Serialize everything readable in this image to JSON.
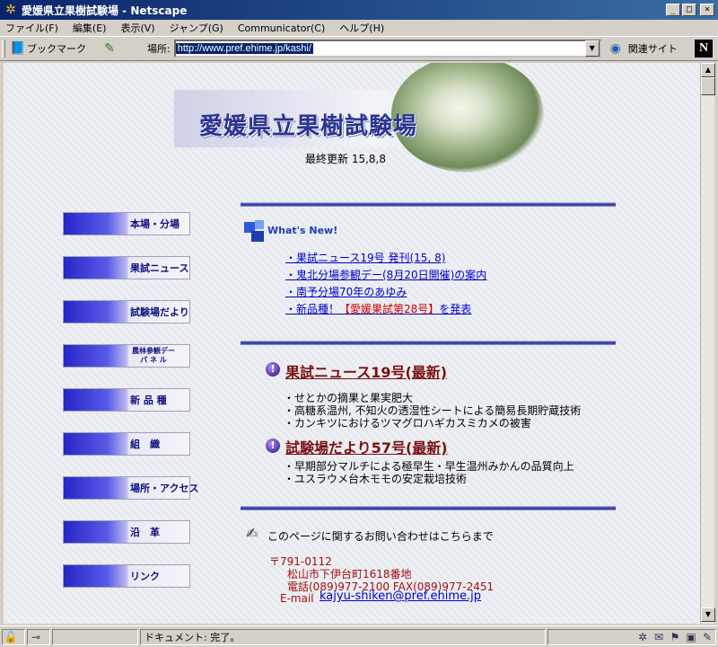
{
  "window": {
    "title": "愛媛県立果樹試験場 - Netscape",
    "min": "_",
    "max": "□",
    "close": "×"
  },
  "menu": [
    "ファイル(F)",
    "編集(E)",
    "表示(V)",
    "ジャンプ(G)",
    "Communicator(C)",
    "ヘルプ(H)"
  ],
  "toolbar": {
    "bookmark_label": "ブックマーク",
    "location_label": "場所:",
    "url": "http://www.pref.ehime.jp/kashi/",
    "related_label": "関連サイト",
    "netscape_logo": "N"
  },
  "page": {
    "site_title": "愛媛県立果樹試験場",
    "last_updated": "最終更新  15,8,8",
    "nav": [
      {
        "label": "本場・分場"
      },
      {
        "label": "果試ニュース"
      },
      {
        "label": "試験場だより"
      },
      {
        "label": "農林参観デー\nパ ネ ル"
      },
      {
        "label": "新 品 種"
      },
      {
        "label": "組　織"
      },
      {
        "label": "場所・アクセス"
      },
      {
        "label": "沿　革"
      },
      {
        "label": "リンク"
      }
    ],
    "whats_new": {
      "label": "What's New!",
      "links": [
        "・果試ニュース19号  発刊(15, 8)",
        "・鬼北分場参観デー(8月20日開催)の案内",
        "・南予分場70年のあゆみ"
      ],
      "link4_prefix": "・新品種！",
      "link4_red": "【愛媛果試第28号】",
      "link4_suffix": "を発表"
    },
    "section1": {
      "title": "果試ニュース19号(最新)",
      "items": [
        "・せとかの摘果と果実肥大",
        "・高糖系温州, 不知火の透湿性シートによる簡易長期貯蔵技術",
        "・カンキツにおけるツマグロハギカスミカメの被害"
      ]
    },
    "section2": {
      "title": "試験場だより57号(最新)",
      "items": [
        "・早期部分マルチによる極早生・早生温州みかんの品質向上",
        "・ユスラウメ台木モモの安定栽培技術"
      ]
    },
    "contact": {
      "text": "このページに関するお問い合わせはこちらまで",
      "postal": "〒791-0112",
      "address": "松山市下伊台町1618番地",
      "phone": "電話(089)977-2100 FAX(089)977-2451",
      "email_label": "E-mail",
      "email": "kajyu-shiken@pref.ehime.jp"
    }
  },
  "status": {
    "text": "ドキュメント: 完了。"
  }
}
